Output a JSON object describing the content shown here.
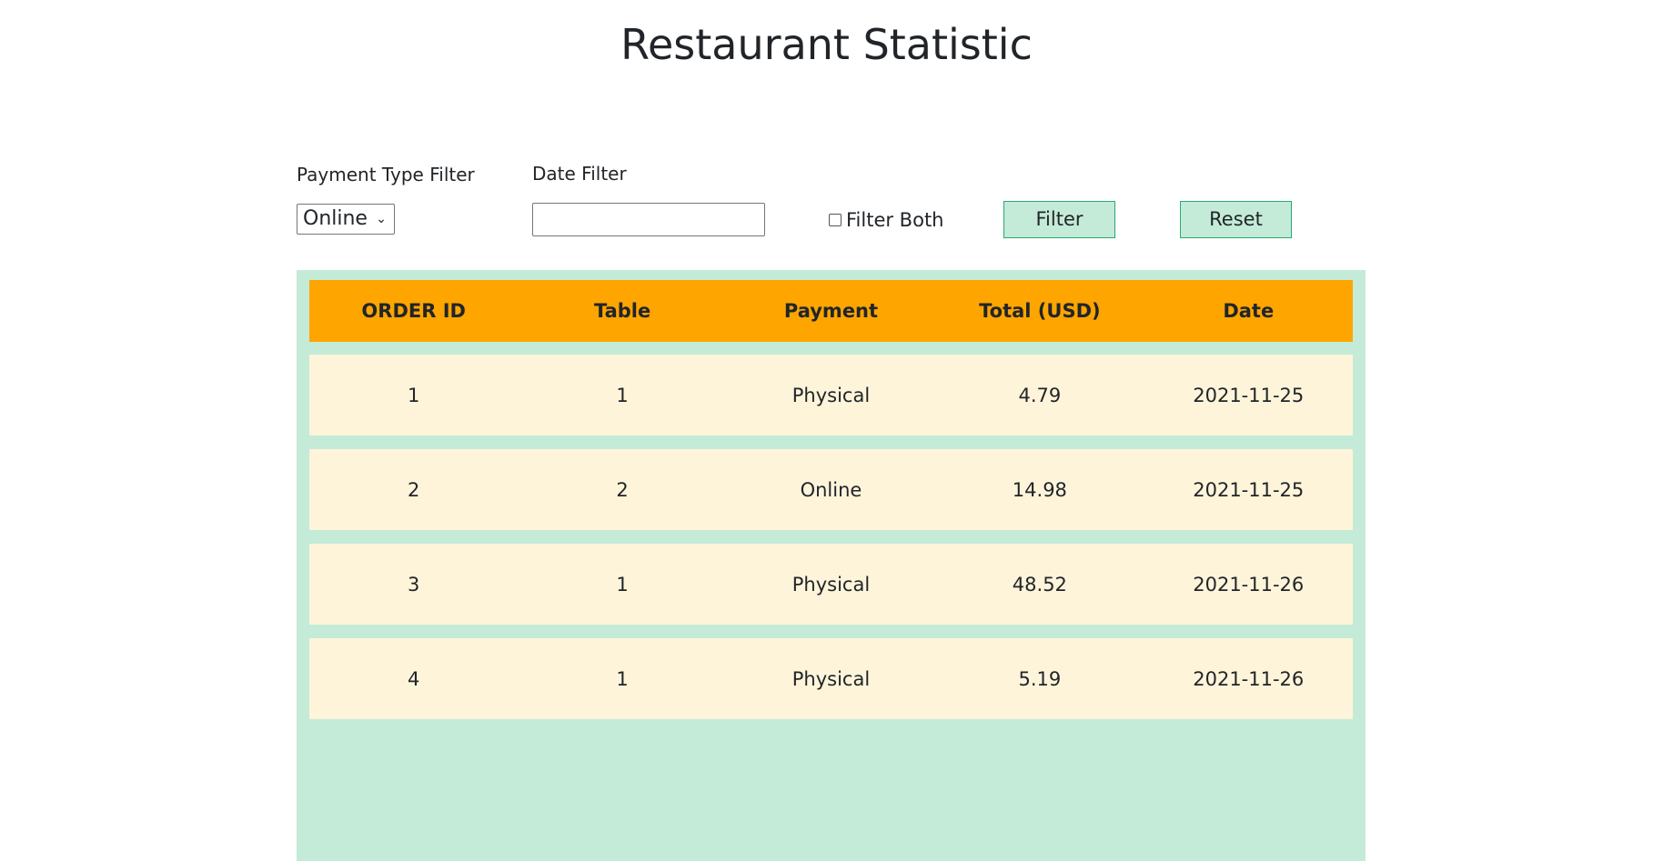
{
  "page": {
    "title": "Restaurant Statistic"
  },
  "filters": {
    "payment_label": "Payment Type Filter",
    "payment_selected": "Online",
    "date_label": "Date Filter",
    "date_value": "",
    "filter_both_label": "Filter Both",
    "filter_both_checked": false,
    "filter_button": "Filter",
    "reset_button": "Reset"
  },
  "table": {
    "headers": [
      "ORDER ID",
      "Table",
      "Payment",
      "Total (USD)",
      "Date"
    ],
    "rows": [
      [
        "1",
        "1",
        "Physical",
        "4.79",
        "2021-11-25"
      ],
      [
        "2",
        "2",
        "Online",
        "14.98",
        "2021-11-25"
      ],
      [
        "3",
        "1",
        "Physical",
        "48.52",
        "2021-11-26"
      ],
      [
        "4",
        "1",
        "Physical",
        "5.19",
        "2021-11-26"
      ]
    ]
  },
  "colors": {
    "panel_bg": "#c4ebd7",
    "header_bg": "#ffa500",
    "row_bg": "#fef4da",
    "button_border": "#2aa876"
  },
  "icons": {
    "select_arrow": "chevron-down-icon"
  }
}
